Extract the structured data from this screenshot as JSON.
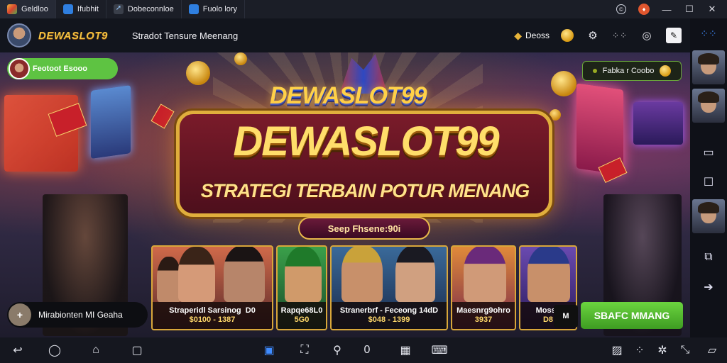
{
  "window": {
    "tabs": [
      {
        "label": "Geldloo",
        "color": "#d8432f"
      },
      {
        "label": "Ifubhit",
        "color": "#2f7fe0"
      },
      {
        "label": "Dobeconnloe",
        "color": "#3a3f4a"
      },
      {
        "label": "Fuolo lory",
        "color": "#2f7fe0"
      }
    ]
  },
  "header": {
    "brand": "DEWASLOT9",
    "title": "Stradot Tensure Meenang",
    "coins_label": "Deoss"
  },
  "stage": {
    "user_pill": "Feotoot Esooo",
    "reward_pill": "Fabka r Coobo",
    "logo_small": "DEWASLOT99",
    "banner_title": "DEWASLOT99",
    "banner_subtitle": "STRATEGI TERBAIN POTUR MENANG",
    "banner_button": "Seep Fhsene:90i",
    "toast_plus": "+",
    "toast_text": "Mirabionten MI Geaha",
    "mini_label": "M",
    "go_button": "SBAFC MMANG"
  },
  "cards": [
    {
      "title": "Straperidl Sarsinog",
      "extra": "D0",
      "sub": "$0100 - 1387"
    },
    {
      "title": "Rapqe68L0",
      "sub": "5G0"
    },
    {
      "title": "Stranerbrf - Feceong 14dD",
      "sub": "$048 - 1399"
    },
    {
      "title": "Maesnrg9ohro",
      "sub": "3937"
    },
    {
      "title": "Mossp",
      "sub": "D8"
    }
  ]
}
